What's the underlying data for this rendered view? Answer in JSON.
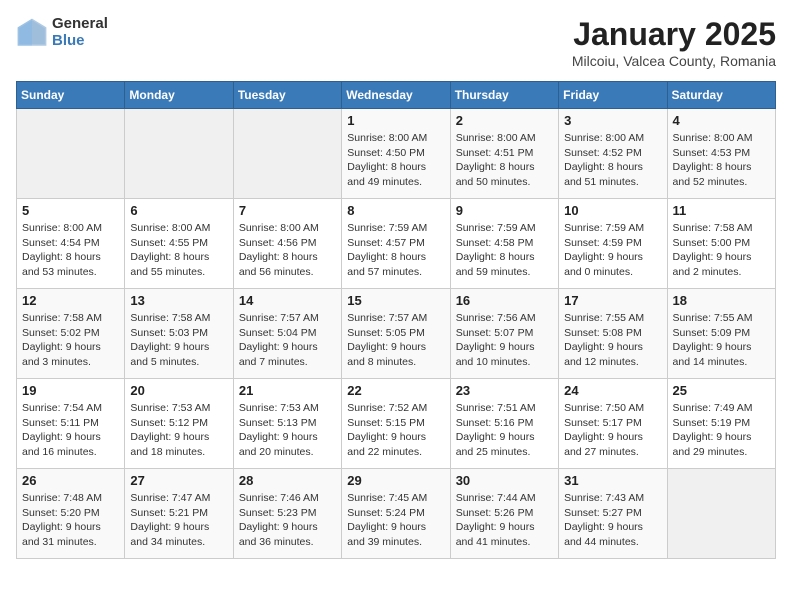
{
  "header": {
    "logo_general": "General",
    "logo_blue": "Blue",
    "title": "January 2025",
    "subtitle": "Milcoiu, Valcea County, Romania"
  },
  "calendar": {
    "days_of_week": [
      "Sunday",
      "Monday",
      "Tuesday",
      "Wednesday",
      "Thursday",
      "Friday",
      "Saturday"
    ],
    "weeks": [
      [
        {
          "date": "",
          "info": ""
        },
        {
          "date": "",
          "info": ""
        },
        {
          "date": "",
          "info": ""
        },
        {
          "date": "1",
          "info": "Sunrise: 8:00 AM\nSunset: 4:50 PM\nDaylight: 8 hours\nand 49 minutes."
        },
        {
          "date": "2",
          "info": "Sunrise: 8:00 AM\nSunset: 4:51 PM\nDaylight: 8 hours\nand 50 minutes."
        },
        {
          "date": "3",
          "info": "Sunrise: 8:00 AM\nSunset: 4:52 PM\nDaylight: 8 hours\nand 51 minutes."
        },
        {
          "date": "4",
          "info": "Sunrise: 8:00 AM\nSunset: 4:53 PM\nDaylight: 8 hours\nand 52 minutes."
        }
      ],
      [
        {
          "date": "5",
          "info": "Sunrise: 8:00 AM\nSunset: 4:54 PM\nDaylight: 8 hours\nand 53 minutes."
        },
        {
          "date": "6",
          "info": "Sunrise: 8:00 AM\nSunset: 4:55 PM\nDaylight: 8 hours\nand 55 minutes."
        },
        {
          "date": "7",
          "info": "Sunrise: 8:00 AM\nSunset: 4:56 PM\nDaylight: 8 hours\nand 56 minutes."
        },
        {
          "date": "8",
          "info": "Sunrise: 7:59 AM\nSunset: 4:57 PM\nDaylight: 8 hours\nand 57 minutes."
        },
        {
          "date": "9",
          "info": "Sunrise: 7:59 AM\nSunset: 4:58 PM\nDaylight: 8 hours\nand 59 minutes."
        },
        {
          "date": "10",
          "info": "Sunrise: 7:59 AM\nSunset: 4:59 PM\nDaylight: 9 hours\nand 0 minutes."
        },
        {
          "date": "11",
          "info": "Sunrise: 7:58 AM\nSunset: 5:00 PM\nDaylight: 9 hours\nand 2 minutes."
        }
      ],
      [
        {
          "date": "12",
          "info": "Sunrise: 7:58 AM\nSunset: 5:02 PM\nDaylight: 9 hours\nand 3 minutes."
        },
        {
          "date": "13",
          "info": "Sunrise: 7:58 AM\nSunset: 5:03 PM\nDaylight: 9 hours\nand 5 minutes."
        },
        {
          "date": "14",
          "info": "Sunrise: 7:57 AM\nSunset: 5:04 PM\nDaylight: 9 hours\nand 7 minutes."
        },
        {
          "date": "15",
          "info": "Sunrise: 7:57 AM\nSunset: 5:05 PM\nDaylight: 9 hours\nand 8 minutes."
        },
        {
          "date": "16",
          "info": "Sunrise: 7:56 AM\nSunset: 5:07 PM\nDaylight: 9 hours\nand 10 minutes."
        },
        {
          "date": "17",
          "info": "Sunrise: 7:55 AM\nSunset: 5:08 PM\nDaylight: 9 hours\nand 12 minutes."
        },
        {
          "date": "18",
          "info": "Sunrise: 7:55 AM\nSunset: 5:09 PM\nDaylight: 9 hours\nand 14 minutes."
        }
      ],
      [
        {
          "date": "19",
          "info": "Sunrise: 7:54 AM\nSunset: 5:11 PM\nDaylight: 9 hours\nand 16 minutes."
        },
        {
          "date": "20",
          "info": "Sunrise: 7:53 AM\nSunset: 5:12 PM\nDaylight: 9 hours\nand 18 minutes."
        },
        {
          "date": "21",
          "info": "Sunrise: 7:53 AM\nSunset: 5:13 PM\nDaylight: 9 hours\nand 20 minutes."
        },
        {
          "date": "22",
          "info": "Sunrise: 7:52 AM\nSunset: 5:15 PM\nDaylight: 9 hours\nand 22 minutes."
        },
        {
          "date": "23",
          "info": "Sunrise: 7:51 AM\nSunset: 5:16 PM\nDaylight: 9 hours\nand 25 minutes."
        },
        {
          "date": "24",
          "info": "Sunrise: 7:50 AM\nSunset: 5:17 PM\nDaylight: 9 hours\nand 27 minutes."
        },
        {
          "date": "25",
          "info": "Sunrise: 7:49 AM\nSunset: 5:19 PM\nDaylight: 9 hours\nand 29 minutes."
        }
      ],
      [
        {
          "date": "26",
          "info": "Sunrise: 7:48 AM\nSunset: 5:20 PM\nDaylight: 9 hours\nand 31 minutes."
        },
        {
          "date": "27",
          "info": "Sunrise: 7:47 AM\nSunset: 5:21 PM\nDaylight: 9 hours\nand 34 minutes."
        },
        {
          "date": "28",
          "info": "Sunrise: 7:46 AM\nSunset: 5:23 PM\nDaylight: 9 hours\nand 36 minutes."
        },
        {
          "date": "29",
          "info": "Sunrise: 7:45 AM\nSunset: 5:24 PM\nDaylight: 9 hours\nand 39 minutes."
        },
        {
          "date": "30",
          "info": "Sunrise: 7:44 AM\nSunset: 5:26 PM\nDaylight: 9 hours\nand 41 minutes."
        },
        {
          "date": "31",
          "info": "Sunrise: 7:43 AM\nSunset: 5:27 PM\nDaylight: 9 hours\nand 44 minutes."
        },
        {
          "date": "",
          "info": ""
        }
      ]
    ]
  }
}
